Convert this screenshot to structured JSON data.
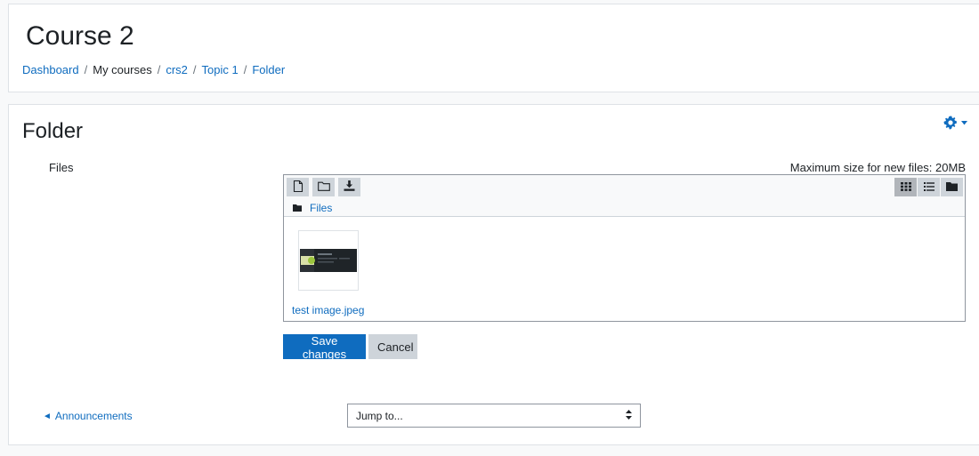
{
  "header": {
    "course_title": "Course 2",
    "breadcrumb": [
      {
        "label": "Dashboard",
        "link": true
      },
      {
        "label": "My courses",
        "link": false
      },
      {
        "label": "crs2",
        "link": true
      },
      {
        "label": "Topic 1",
        "link": true
      },
      {
        "label": "Folder",
        "link": true
      }
    ],
    "separator": "/"
  },
  "main": {
    "title": "Folder",
    "settings_icon": "gear-icon",
    "files_label": "Files",
    "max_size_text": "Maximum size for new files: 20MB",
    "filemanager": {
      "toolbar_left": [
        "create-file-icon",
        "create-folder-icon",
        "download-icon"
      ],
      "toolbar_right": [
        "icon-view-icon",
        "list-view-icon",
        "tree-view-icon"
      ],
      "active_view": "icon-view",
      "path_label": "Files",
      "files": [
        {
          "name": "test image.jpeg",
          "type": "image"
        }
      ]
    },
    "buttons": {
      "save": "Save changes",
      "cancel": "Cancel"
    },
    "navigation": {
      "prev_arrow": "◄",
      "prev_label": "Announcements",
      "jump_to": "Jump to..."
    }
  },
  "colors": {
    "primary": "#0f6cbf",
    "secondary": "#ced4da",
    "text": "#1d2125",
    "background": "#f8f9fa"
  }
}
